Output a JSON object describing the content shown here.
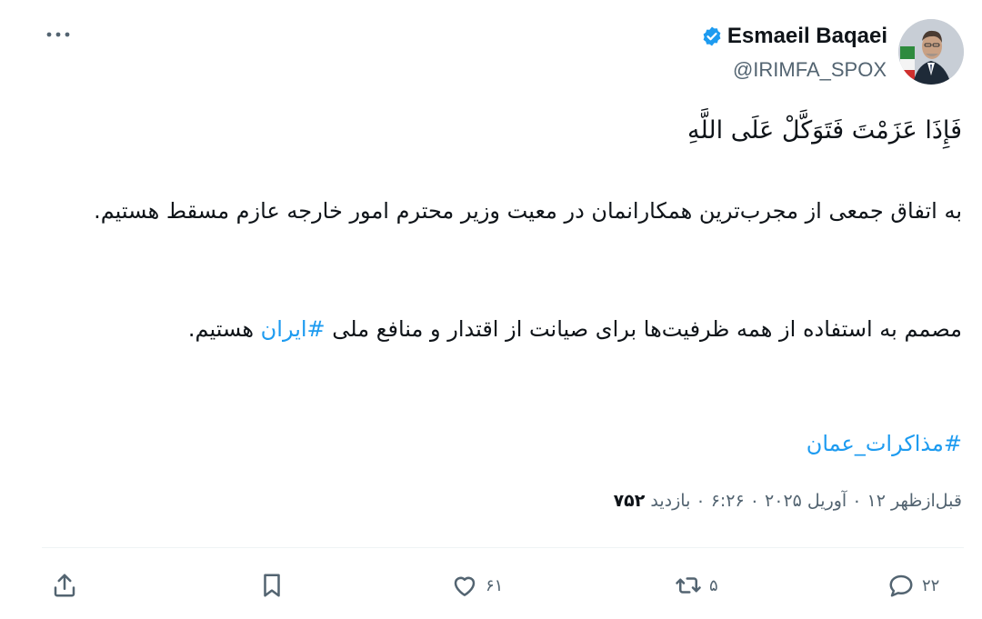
{
  "author": {
    "name": "Esmaeil Baqaei",
    "handle": "@IRIMFA_SPOX",
    "verified_color": "#1d9bf0"
  },
  "menu": {
    "icon": "more-dots-icon"
  },
  "tweet": {
    "verse": "فَإِذَا عَزَمْتَ فَتَوَكَّلْ عَلَى اللَّهِ",
    "paragraph1": "به اتفاق جمعی از مجرب‌ترین همکارانمان در معیت وزیر محترم امور خارجه عازم مسقط هستیم.",
    "paragraph2_text": "مصمم به استفاده از همه ظرفیت‌ها برای صیانت از اقتدار و منافع ملی ",
    "paragraph2_hashtag": "#ایران",
    "paragraph2_end": " هستیم.",
    "hashtag_line": "#مذاکرات_عمان",
    "link_color": "#1d9bf0"
  },
  "meta": {
    "timestamp": "قبل‌ازظهر ۱۲ ۰ آوریل ۲۰۲۵ ۰ ۶:۲۶ ۰ بازدید",
    "views": "۷۵۲"
  },
  "actions": {
    "reply": {
      "icon": "reply-icon",
      "count": "۲۲"
    },
    "retweet": {
      "icon": "retweet-icon",
      "count": "۵"
    },
    "like": {
      "icon": "heart-icon",
      "count": "۶۱"
    },
    "bookmark": {
      "icon": "bookmark-icon"
    },
    "share": {
      "icon": "share-icon"
    }
  }
}
